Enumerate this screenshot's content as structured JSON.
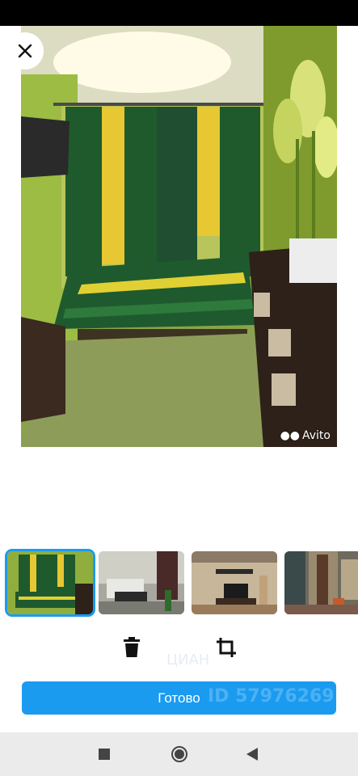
{
  "viewer": {
    "close_icon": "close-icon",
    "watermark": "Avito"
  },
  "thumbnails": [
    {
      "name": "thumbnail-bedroom",
      "selected": true
    },
    {
      "name": "thumbnail-living-room",
      "selected": false
    },
    {
      "name": "thumbnail-tv-room",
      "selected": false
    },
    {
      "name": "thumbnail-hallway",
      "selected": false
    }
  ],
  "toolbar": {
    "delete_icon": "trash-icon",
    "crop_icon": "crop-icon"
  },
  "done_button": {
    "label": "Готово"
  },
  "watermark_text": {
    "faint_top": "ЦИАН",
    "id_text": "ID 57976269"
  },
  "nav": {
    "recent_icon": "square-icon",
    "home_icon": "circle-icon",
    "back_icon": "triangle-back-icon"
  },
  "colors": {
    "accent": "#1a9bf0",
    "status_bar": "#000000",
    "nav_bar": "#ebebeb"
  }
}
